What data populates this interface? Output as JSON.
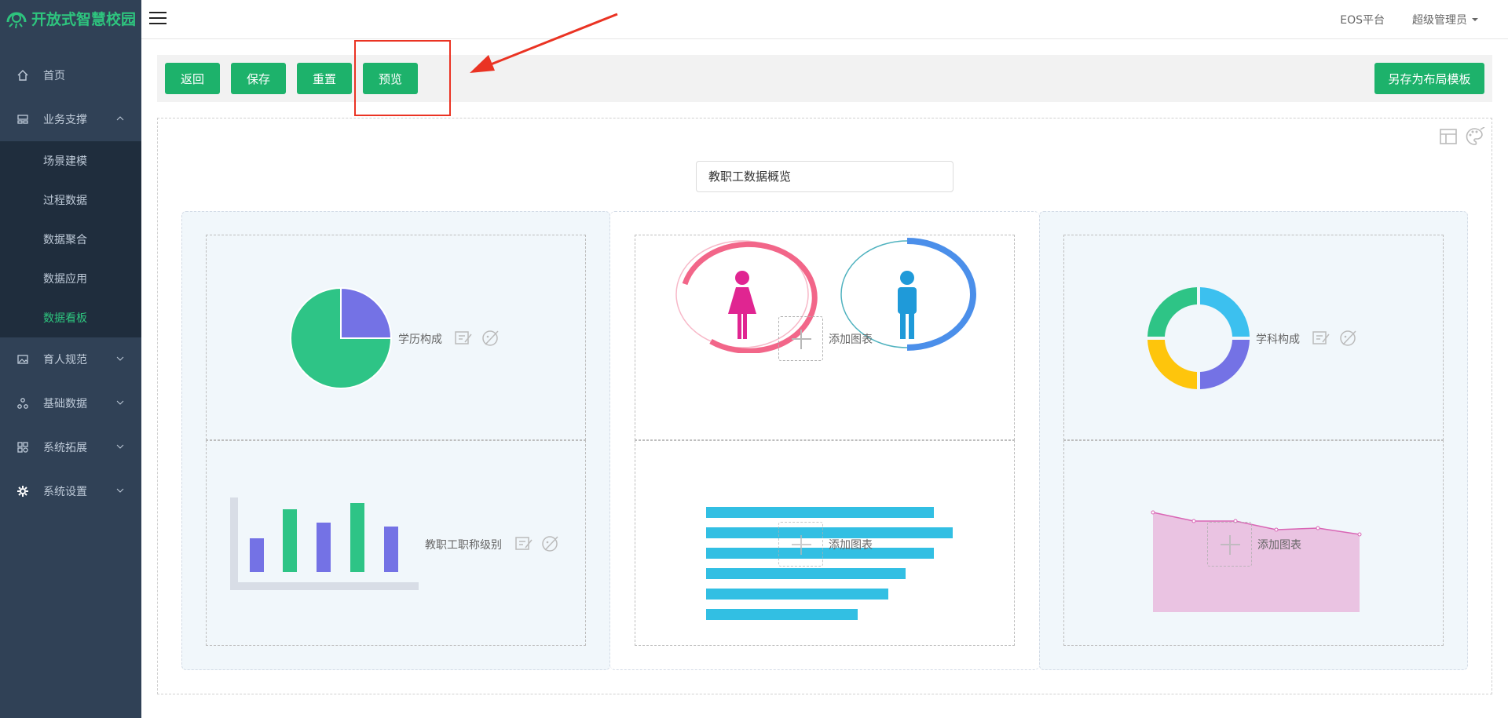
{
  "app": {
    "logo_text": "开放式智慧校园"
  },
  "sidebar": {
    "items": [
      {
        "label": "首页",
        "icon": "home-icon"
      },
      {
        "label": "业务支撑",
        "icon": "board-icon",
        "expanded": true,
        "children": [
          {
            "label": "场景建模"
          },
          {
            "label": "过程数据"
          },
          {
            "label": "数据聚合"
          },
          {
            "label": "数据应用"
          },
          {
            "label": "数据看板",
            "active": true
          }
        ]
      },
      {
        "label": "育人规范",
        "icon": "image-icon"
      },
      {
        "label": "基础数据",
        "icon": "cluster-icon"
      },
      {
        "label": "系统拓展",
        "icon": "apps-icon"
      },
      {
        "label": "系统设置",
        "icon": "gear-icon"
      }
    ]
  },
  "topbar": {
    "platform": "EOS平台",
    "user": "超级管理员"
  },
  "toolbar": {
    "back": "返回",
    "save": "保存",
    "reset": "重置",
    "preview": "预览",
    "save_template": "另存为布局模板"
  },
  "dashboard": {
    "title": "教职工数据概览",
    "cells": {
      "education": "学历构成",
      "title_level": "教职工职称级别",
      "add_chart_1": "添加图表",
      "add_chart_2": "添加图表",
      "subject": "学科构成",
      "add_chart_3": "添加图表"
    }
  },
  "colors": {
    "accent": "#1db26b",
    "sidebar_bg": "#304156",
    "sidebar_sub_bg": "#1f2d3d",
    "annotation": "#ea3323"
  }
}
